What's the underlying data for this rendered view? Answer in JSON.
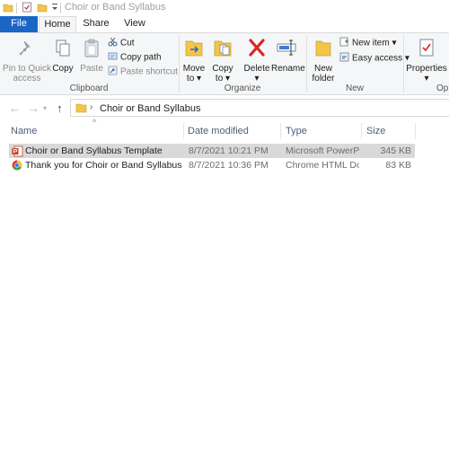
{
  "window": {
    "title": "Choir or Band Syllabus"
  },
  "tabs": [
    {
      "label": "File"
    },
    {
      "label": "Home"
    },
    {
      "label": "Share"
    },
    {
      "label": "View"
    }
  ],
  "ribbon": {
    "clipboard": {
      "label": "Clipboard",
      "pin": "Pin to Quick access",
      "pin_line1": "Pin to Quick",
      "pin_line2": "access",
      "copy": "Copy",
      "paste": "Paste",
      "cut": "Cut",
      "copy_path": "Copy path",
      "paste_shortcut": "Paste shortcut"
    },
    "organize": {
      "label": "Organize",
      "move_to": "Move",
      "move_to2": "to",
      "copy_to": "Copy",
      "copy_to2": "to",
      "delete": "Delete",
      "rename": "Rename"
    },
    "new": {
      "label": "New",
      "new_folder": "New",
      "new_folder2": "folder",
      "new_item": "New item",
      "easy_access": "Easy access"
    },
    "open": {
      "label": "Op",
      "properties": "Properties"
    }
  },
  "address": {
    "breadcrumb": "Choir or Band Syllabus"
  },
  "columns": {
    "name": "Name",
    "date": "Date modified",
    "type": "Type",
    "size": "Size"
  },
  "files": [
    {
      "name": "Choir or Band Syllabus Template",
      "date": "8/7/2021 10:21 PM",
      "type": "Microsoft PowerP...",
      "size": "345 KB",
      "icon": "powerpoint-file-icon"
    },
    {
      "name": "Thank you for Choir or Band Syllabus",
      "date": "8/7/2021 10:36 PM",
      "type": "Chrome HTML Do...",
      "size": "83 KB",
      "icon": "chrome-html-file-icon"
    }
  ],
  "colors": {
    "file_tab": "#1a66c7",
    "ribbon_bg": "#f5f6f7",
    "selected_row": "#d9d9d9",
    "delete_red": "#d42828",
    "folder_yellow": "#f3c54a"
  }
}
